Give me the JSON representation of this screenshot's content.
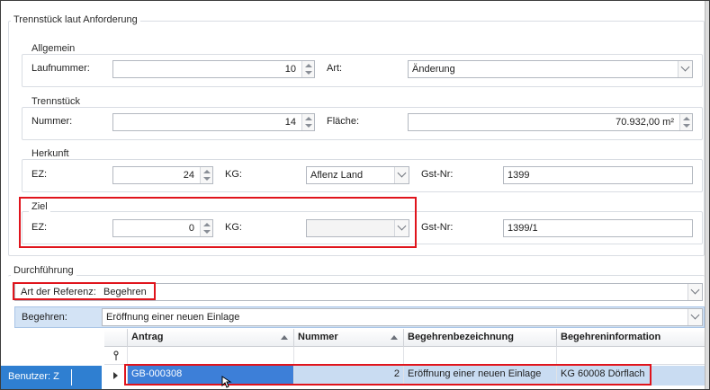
{
  "main_group": {
    "title": "Trennstück laut Anforderung"
  },
  "allgemein": {
    "title": "Allgemein",
    "laufnummer_label": "Laufnummer:",
    "laufnummer_value": "10",
    "art_label": "Art:",
    "art_value": "Änderung"
  },
  "trennstueck": {
    "title": "Trennstück",
    "nummer_label": "Nummer:",
    "nummer_value": "14",
    "flaeche_label": "Fläche:",
    "flaeche_value": "70.932,00 m²"
  },
  "herkunft": {
    "title": "Herkunft",
    "ez_label": "EZ:",
    "ez_value": "24",
    "kg_label": "KG:",
    "kg_value": "Aflenz Land",
    "gst_label": "Gst-Nr:",
    "gst_value": "1399"
  },
  "ziel": {
    "title": "Ziel",
    "ez_label": "EZ:",
    "ez_value": "0",
    "kg_label": "KG:",
    "kg_value": "",
    "gst_label": "Gst-Nr:",
    "gst_value": "1399/1"
  },
  "durchfuehrung": {
    "title": "Durchführung",
    "ref_label": "Art der Referenz:",
    "ref_value": "Begehren",
    "begehren_label": "Begehren:",
    "begehren_value": "Eröffnung einer neuen Einlage"
  },
  "grid": {
    "columns": [
      "Antrag",
      "Nummer",
      "Begehrenbezeichnung",
      "Begehreninformation"
    ],
    "rows": [
      {
        "antrag": "GB-000308",
        "nummer": "2",
        "bezeichnung": "Eröffnung einer neuen Einlage",
        "information": "KG 60008 Dörflach"
      }
    ]
  },
  "statusbar": {
    "user_text": "Benutzer: Z"
  },
  "colors": {
    "highlight_red": "#e0141c",
    "selection_blue": "#3d7fd8",
    "status_blue": "#2f7fd1"
  }
}
